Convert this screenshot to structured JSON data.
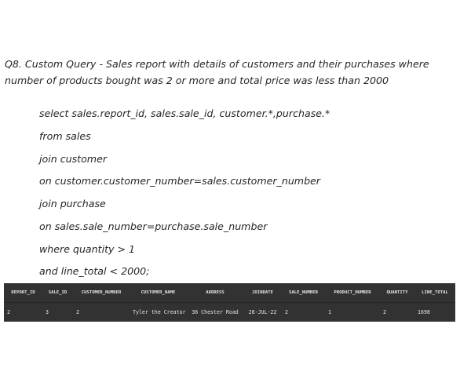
{
  "question": "Q8. Custom Query - Sales report with details of customers and their purchases where number of products bought was 2 or more and total price was less than 2000",
  "query_lines": [
    "select sales.report_id, sales.sale_id, customer.*,purchase.*",
    "from sales",
    "join customer",
    "on customer.customer_number=sales.customer_number",
    "join purchase",
    "on sales.sale_number=purchase.sale_number",
    "where quantity > 1",
    "and line_total < 2000;"
  ],
  "result": {
    "columns": [
      "REPORT_ID",
      "SALE_ID",
      "CUSTOMER_NUMBER",
      "CUSTOMER_NAME",
      "ADDRESS",
      "JOINDATE",
      "SALE_NUMBER",
      "PRODUCT_NUMBER",
      "QUANTITY",
      "LINE_TOTAL"
    ],
    "rows": [
      [
        "2",
        "3",
        "2",
        "Tyler the Creator",
        "36 Chester Road",
        "28-JUL-22",
        "2",
        "1",
        "2",
        "1698"
      ]
    ]
  }
}
